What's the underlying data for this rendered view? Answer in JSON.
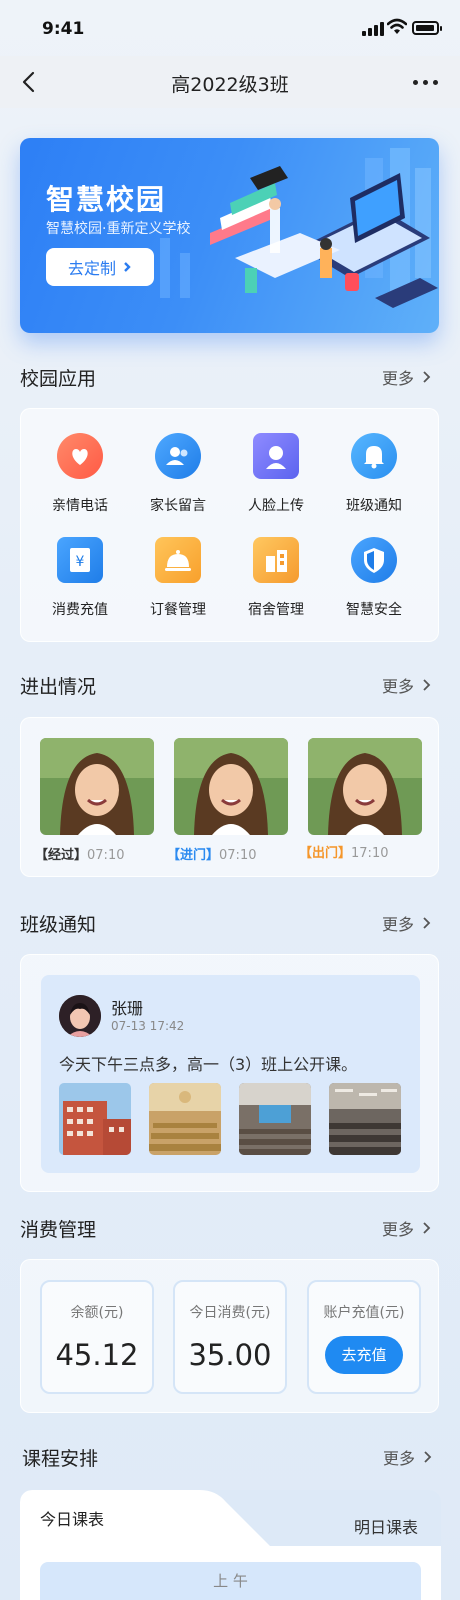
{
  "status_bar": {
    "time": "9:41"
  },
  "nav": {
    "title": "高2022级3班"
  },
  "banner": {
    "title": "智慧校园",
    "subtitle": "智慧校园·重新定义学校",
    "button": "去定制"
  },
  "campus_apps": {
    "title": "校园应用",
    "more": "更多",
    "items": [
      {
        "label": "亲情电话",
        "icon": "heart-phone-icon",
        "color": "#ff6a50"
      },
      {
        "label": "家长留言",
        "icon": "parent-message-icon",
        "color": "#2d8ff0"
      },
      {
        "label": "人脸上传",
        "icon": "face-upload-icon",
        "color": "#6d74f5"
      },
      {
        "label": "班级通知",
        "icon": "bell-icon",
        "color": "#2f9af5"
      },
      {
        "label": "消费充值",
        "icon": "yuan-recharge-icon",
        "color": "#2d8ff0"
      },
      {
        "label": "订餐管理",
        "icon": "dining-cloche-icon",
        "color": "#f8a83a"
      },
      {
        "label": "宿舍管理",
        "icon": "dormitory-icon",
        "color": "#f7a93c"
      },
      {
        "label": "智慧安全",
        "icon": "shield-icon",
        "color": "#2d8ff0"
      }
    ]
  },
  "access": {
    "title": "进出情况",
    "more": "更多",
    "records": [
      {
        "tag": "【经过】",
        "time": "07:10",
        "color": "#333333"
      },
      {
        "tag": "【进门】",
        "time": "07:10",
        "color": "#2b8af0"
      },
      {
        "tag": "【出门】",
        "time": "17:10",
        "color": "#f5962a"
      }
    ]
  },
  "notice": {
    "title": "班级通知",
    "more": "更多",
    "author": "张珊",
    "time": "07-13 17:42",
    "content": "今天下午三点多，高一（3）班上公开课。"
  },
  "consume": {
    "title": "消费管理",
    "more": "更多",
    "balance_label": "余额(元)",
    "balance": "45.12",
    "today_label": "今日消费(元)",
    "today": "35.00",
    "recharge_label": "账户充值(元)",
    "recharge_button": "去充值"
  },
  "schedule": {
    "title": "课程安排",
    "more": "更多",
    "tab_today": "今日课表",
    "tab_tomorrow": "明日课表",
    "period": "上 午"
  }
}
